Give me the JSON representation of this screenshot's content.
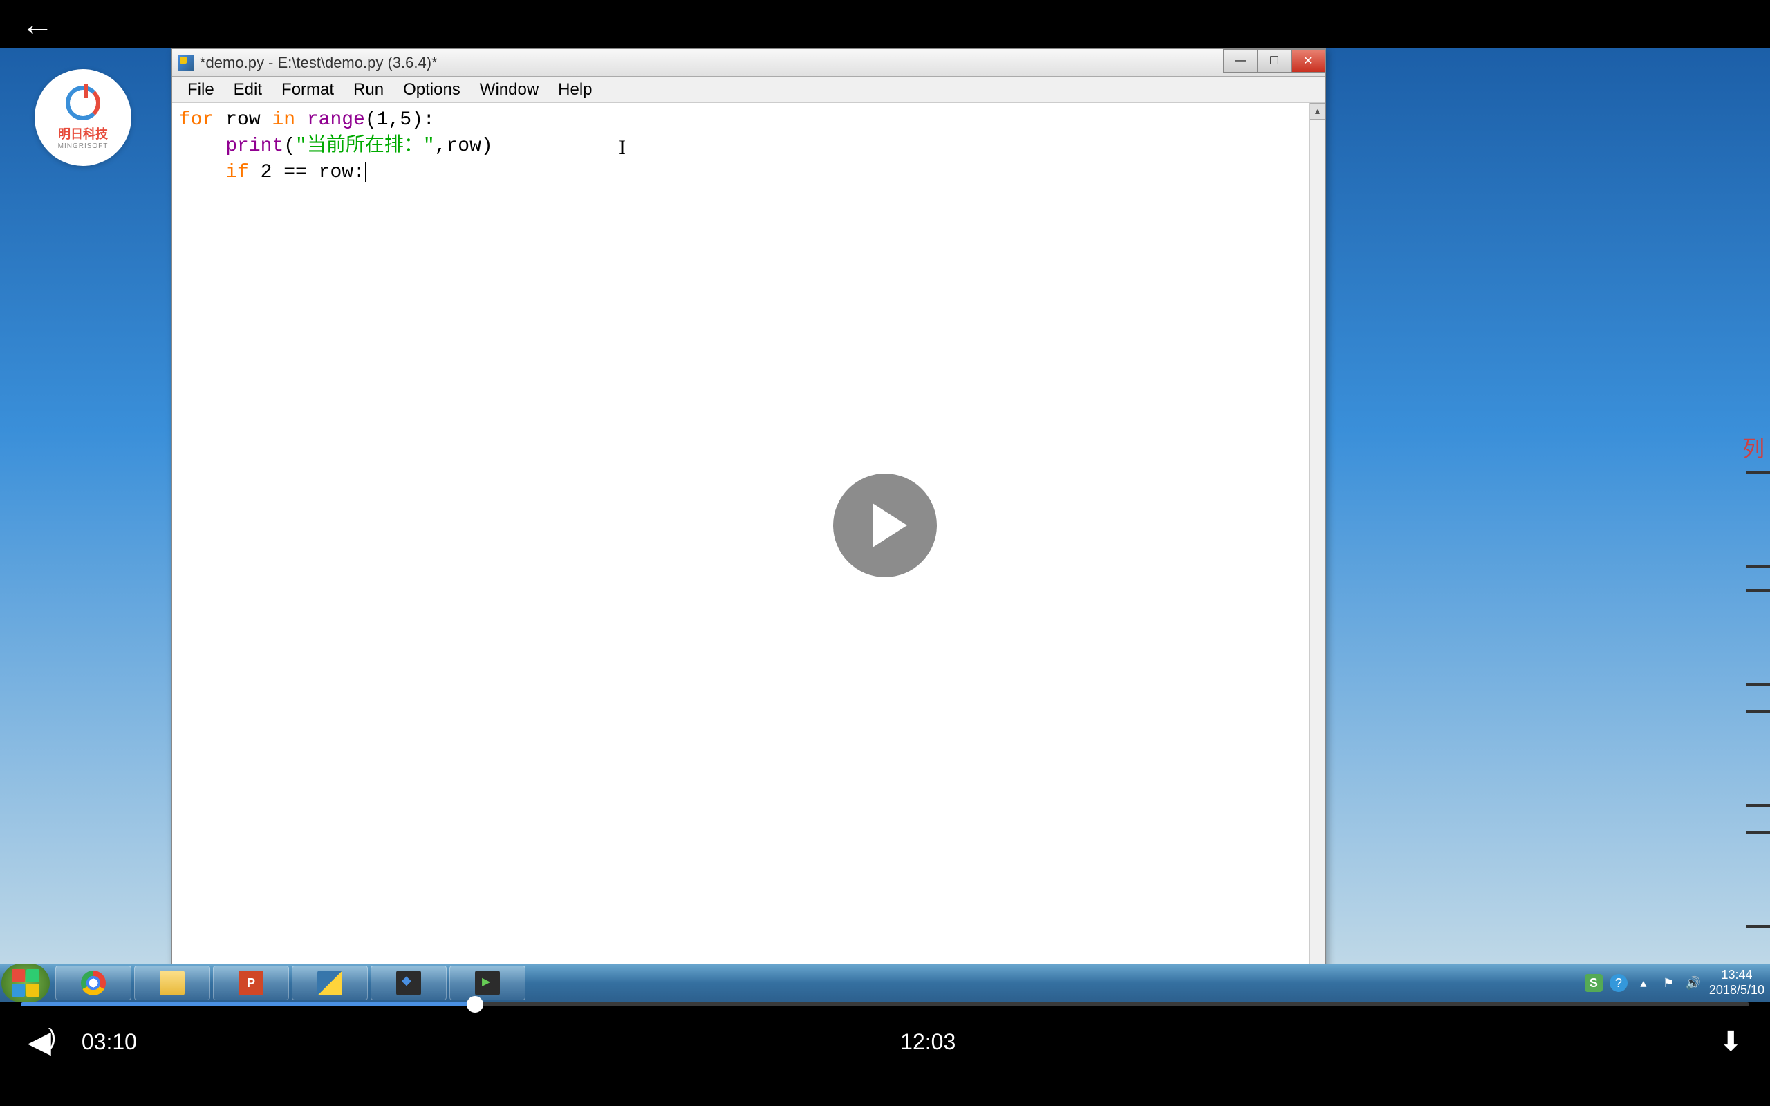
{
  "player": {
    "current_time": "03:10",
    "duration": "12:03"
  },
  "logo": {
    "text": "明日科技",
    "sub": "MINGRISOFT"
  },
  "idle": {
    "title": "*demo.py - E:\\test\\demo.py (3.6.4)*",
    "menu": [
      "File",
      "Edit",
      "Format",
      "Run",
      "Options",
      "Window",
      "Help"
    ],
    "code": {
      "l1_kw1": "for",
      "l1_var": " row ",
      "l1_kw2": "in",
      "l1_fn": " range",
      "l1_rest": "(1,5):",
      "l2_indent": "    ",
      "l2_fn": "print",
      "l2_p1": "(",
      "l2_str": "\"当前所在排：\"",
      "l2_p2": ",row)",
      "l3_indent": "    ",
      "l3_kw": "if",
      "l3_rest": " 2 == row:"
    }
  },
  "right_label": "列",
  "taskbar": {
    "items": [
      "chrome",
      "folder",
      "powerpoint",
      "python",
      "app1",
      "app2"
    ],
    "tray_s": "S",
    "tray_q": "?",
    "clock_time": "13:44",
    "clock_date": "2018/5/10"
  }
}
